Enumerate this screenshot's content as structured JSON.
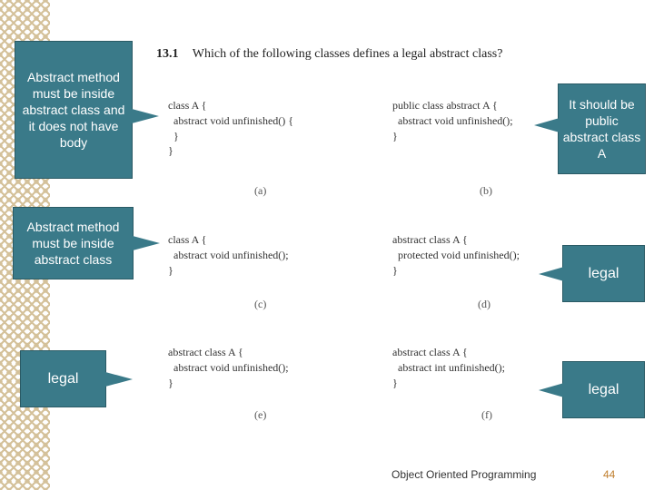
{
  "question": {
    "num": "13.1",
    "text": "Which of the following classes defines a legal abstract class?"
  },
  "code": {
    "a": "class A {\n  abstract void unfinished() {\n  }\n}",
    "b": "public class abstract A {\n  abstract void unfinished();\n}",
    "c": "class A {\n  abstract void unfinished();\n}",
    "d": "abstract class A {\n  protected void unfinished();\n}",
    "e": "abstract class A {\n  abstract void unfinished();\n}",
    "f": "abstract class A {\n  abstract int unfinished();\n}"
  },
  "labels": {
    "a": "(a)",
    "b": "(b)",
    "c": "(c)",
    "d": "(d)",
    "e": "(e)",
    "f": "(f)"
  },
  "callouts": {
    "r1l": "Abstract method must be inside abstract class and\nit does not have body",
    "r1r": "It should be public abstract class A",
    "r2l": "Abstract method must be inside abstract class",
    "r2r": "legal",
    "r3l": "legal",
    "r3r": "legal"
  },
  "footer": "Object Oriented Programming",
  "slide_num": "44"
}
